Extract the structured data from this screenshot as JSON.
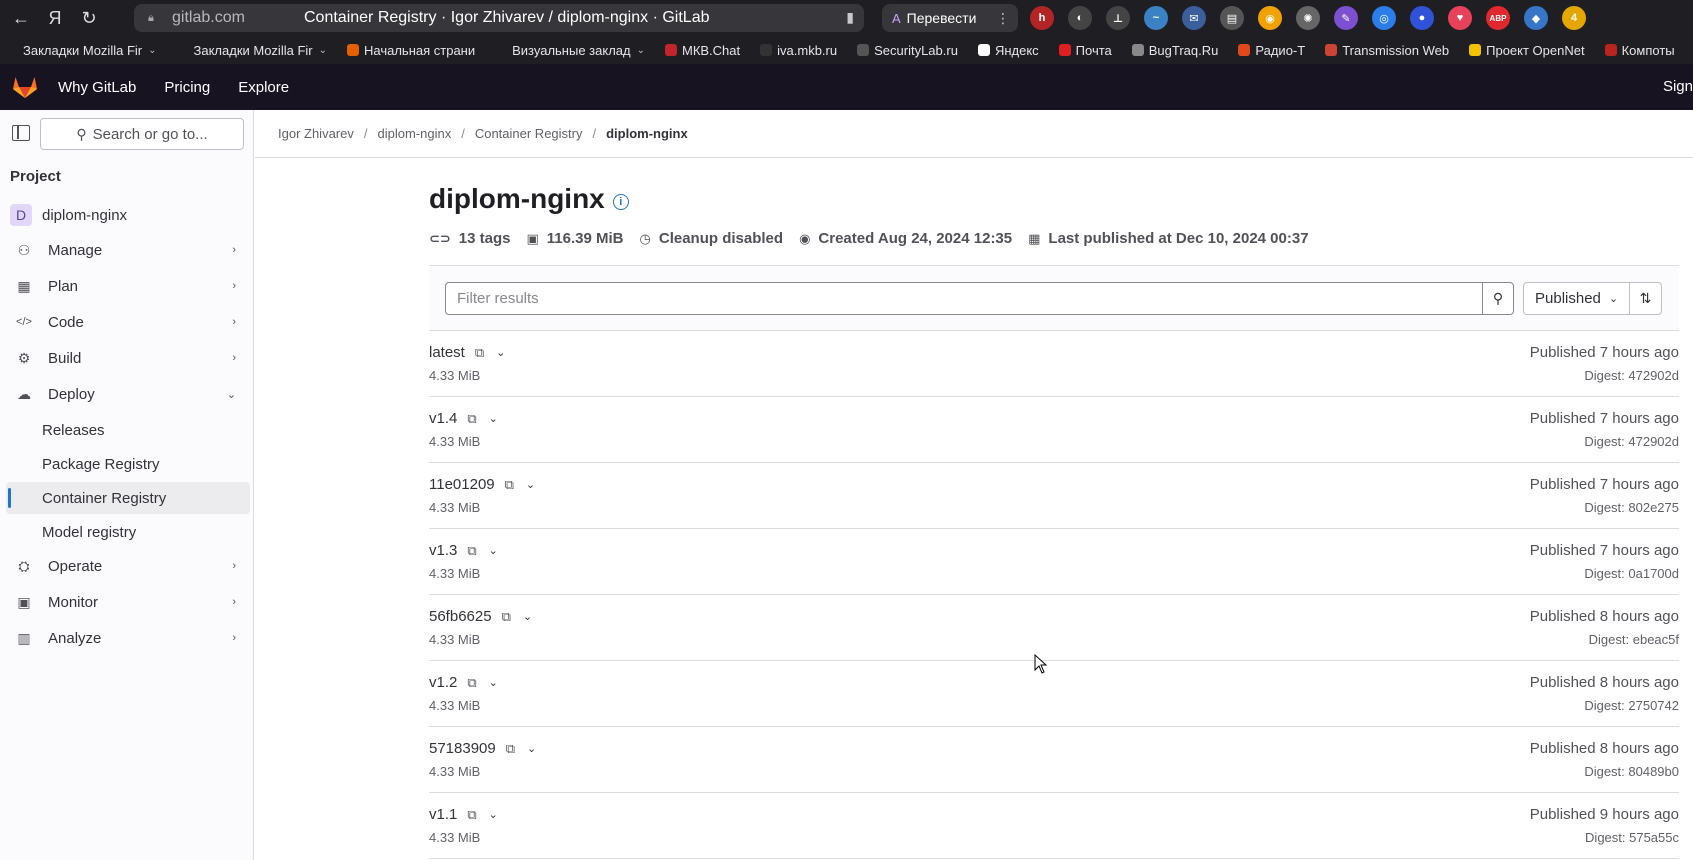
{
  "browser": {
    "domain": "gitlab.com",
    "tab_title": "Container Registry · Igor Zhivarev / diplom-nginx · GitLab",
    "translate_label": "Перевести",
    "extensions": [
      {
        "name": "h-icon",
        "label": "h",
        "color": "#b32424"
      },
      {
        "name": "bulb-icon",
        "label": "◐",
        "color": "#444"
      },
      {
        "name": "stamp-icon",
        "label": "⊥",
        "color": "#444"
      },
      {
        "name": "bird-icon",
        "label": "~",
        "color": "#3b82c4"
      },
      {
        "name": "mail-icon",
        "label": "✉",
        "color": "#3a5f9c"
      },
      {
        "name": "printer-icon",
        "label": "▤",
        "color": "#555"
      },
      {
        "name": "fox-icon",
        "label": "◉",
        "color": "#f2a200"
      },
      {
        "name": "gear-icon",
        "label": "✺",
        "color": "#666"
      },
      {
        "name": "feather-icon",
        "label": "✎",
        "color": "#7d4fd1"
      },
      {
        "name": "chrome-icon",
        "label": "◎",
        "color": "#2b7de9"
      },
      {
        "name": "vpn-icon",
        "label": "●",
        "color": "#2f52d8"
      },
      {
        "name": "pocket-icon",
        "label": "♥",
        "color": "#e8425a"
      },
      {
        "name": "abp-icon",
        "label": "ABP",
        "color": "#e0282e"
      },
      {
        "name": "shield-icon",
        "label": "◆",
        "color": "#3576c9"
      },
      {
        "name": "counter-icon",
        "label": "4",
        "color": "#e5a600"
      }
    ]
  },
  "bookmarks": [
    {
      "label": "Закладки Mozilla Fir",
      "dropdown": true,
      "color": "#1f1f23"
    },
    {
      "label": "Закладки Mozilla Fir",
      "dropdown": true,
      "color": "#1f1f23"
    },
    {
      "label": "Начальная страни",
      "dropdown": false,
      "color": "#e66000"
    },
    {
      "label": "Визуальные заклад",
      "dropdown": true,
      "color": "#1f1f23"
    },
    {
      "label": "МКВ.Chat",
      "dropdown": false,
      "color": "#c4242b"
    },
    {
      "label": "iva.mkb.ru",
      "dropdown": false,
      "color": "#333"
    },
    {
      "label": "SecurityLab.ru",
      "dropdown": false,
      "color": "#555"
    },
    {
      "label": "Яндекс",
      "dropdown": false,
      "color": "#fff"
    },
    {
      "label": "Почта",
      "dropdown": false,
      "color": "#e02020"
    },
    {
      "label": "BugTraq.Ru",
      "dropdown": false,
      "color": "#888"
    },
    {
      "label": "Радио-Т",
      "dropdown": false,
      "color": "#e04a1b"
    },
    {
      "label": "Transmission Web",
      "dropdown": false,
      "color": "#c43"
    },
    {
      "label": "Проект OpenNet",
      "dropdown": false,
      "color": "#f2c200"
    },
    {
      "label": "Компоты",
      "dropdown": false,
      "color": "#b9241f"
    }
  ],
  "gitlab_nav": {
    "why": "Why GitLab",
    "pricing": "Pricing",
    "explore": "Explore",
    "sign": "Sign"
  },
  "sidebar": {
    "search_label": "Search or go to...",
    "heading": "Project",
    "project_avatar": "D",
    "project_name": "diplom-nginx",
    "items": [
      {
        "label": "Manage",
        "icon": "⚇"
      },
      {
        "label": "Plan",
        "icon": "▦"
      },
      {
        "label": "Code",
        "icon": "</>"
      },
      {
        "label": "Build",
        "icon": "⚙"
      },
      {
        "label": "Deploy",
        "icon": "☁"
      },
      {
        "label": "Operate",
        "icon": "⛭"
      },
      {
        "label": "Monitor",
        "icon": "▣"
      },
      {
        "label": "Analyze",
        "icon": "▥"
      }
    ],
    "deploy_sub": [
      {
        "label": "Releases"
      },
      {
        "label": "Package Registry"
      },
      {
        "label": "Container Registry"
      },
      {
        "label": "Model registry"
      }
    ]
  },
  "breadcrumb": [
    "Igor Zhivarev",
    "diplom-nginx",
    "Container Registry",
    "diplom-nginx"
  ],
  "page": {
    "title": "diplom-nginx",
    "meta": {
      "tags": "13 tags",
      "size": "116.39 MiB",
      "cleanup": "Cleanup disabled",
      "created": "Created Aug 24, 2024 12:35",
      "published": "Last published at Dec 10, 2024 00:37"
    },
    "filter_placeholder": "Filter results",
    "sort_label": "Published"
  },
  "tags": [
    {
      "name": "latest",
      "size": "4.33 MiB",
      "published": "Published 7 hours ago",
      "digest": "Digest: 472902d"
    },
    {
      "name": "v1.4",
      "size": "4.33 MiB",
      "published": "Published 7 hours ago",
      "digest": "Digest: 472902d"
    },
    {
      "name": "11e01209",
      "size": "4.33 MiB",
      "published": "Published 7 hours ago",
      "digest": "Digest: 802e275"
    },
    {
      "name": "v1.3",
      "size": "4.33 MiB",
      "published": "Published 7 hours ago",
      "digest": "Digest: 0a1700d"
    },
    {
      "name": "56fb6625",
      "size": "4.33 MiB",
      "published": "Published 8 hours ago",
      "digest": "Digest: ebeac5f"
    },
    {
      "name": "v1.2",
      "size": "4.33 MiB",
      "published": "Published 8 hours ago",
      "digest": "Digest: 2750742"
    },
    {
      "name": "57183909",
      "size": "4.33 MiB",
      "published": "Published 8 hours ago",
      "digest": "Digest: 80489b0"
    },
    {
      "name": "v1.1",
      "size": "4.33 MiB",
      "published": "Published 9 hours ago",
      "digest": "Digest: 575a55c"
    }
  ]
}
